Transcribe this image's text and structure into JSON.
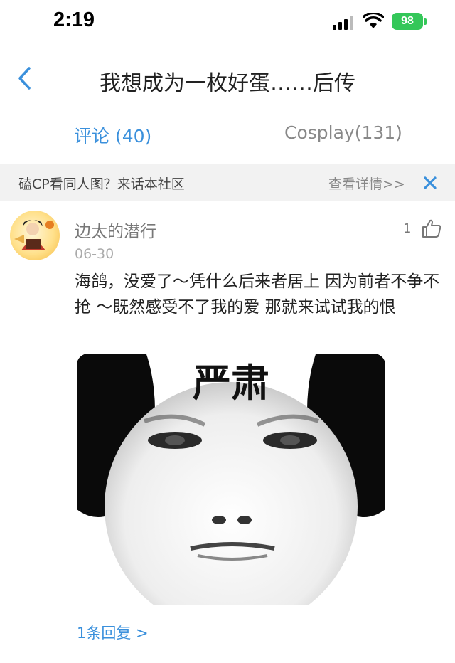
{
  "status_bar": {
    "time": "2:19",
    "battery": "98"
  },
  "nav": {
    "title": "我想成为一枚好蛋……后传",
    "back_icon": "chevron-left-icon"
  },
  "tabs": [
    {
      "label": "评论 (40)",
      "active": true
    },
    {
      "label": "Cosplay(131)",
      "active": false
    }
  ],
  "banner": {
    "text": "磕CP看同人图？来话本社区",
    "link": "查看详情>>"
  },
  "comment": {
    "username": "边太的潜行",
    "date": "06-30",
    "likes": "1",
    "text": "海鸽，没爱了～凭什么后来者居上 因为前者不争不抢 ～既然感受不了我的爱 那就来试试我的恨",
    "image_caption": "严肃",
    "replies": "1条回复 >"
  },
  "colors": {
    "accent": "#3a90dc",
    "battery": "#34c759"
  }
}
